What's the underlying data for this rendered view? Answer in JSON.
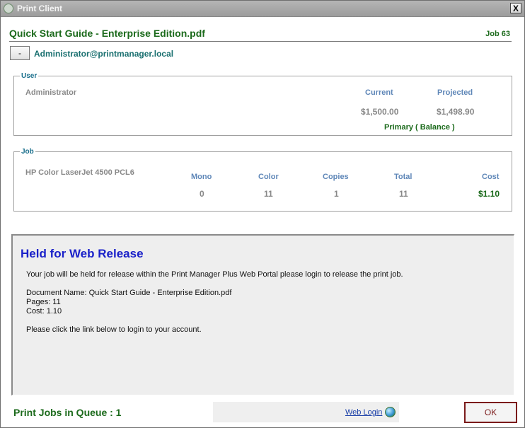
{
  "window": {
    "title": "Print Client",
    "close_glyph": "X"
  },
  "header": {
    "document_title": "Quick Start Guide - Enterprise Edition.pdf",
    "job_label": "Job 63",
    "collapse_label": "-",
    "account": "Administrator@printmanager.local"
  },
  "user": {
    "legend": "User",
    "name": "Administrator",
    "current_label": "Current",
    "projected_label": "Projected",
    "current_value": "$1,500.00",
    "projected_value": "$1,498.90",
    "account_type": "Primary ( Balance )"
  },
  "job": {
    "legend": "Job",
    "printer": "HP Color LaserJet 4500 PCL6",
    "columns": [
      {
        "label": "Mono",
        "value": "0"
      },
      {
        "label": "Color",
        "value": "11"
      },
      {
        "label": "Copies",
        "value": "1"
      },
      {
        "label": "Total",
        "value": "11"
      },
      {
        "label": "Cost",
        "value": "$1.10"
      }
    ]
  },
  "held": {
    "heading": "Held for Web Release",
    "message": "Your job will be held for release within the Print Manager Plus Web Portal please login to release the print job.",
    "document_line": "Document Name: Quick Start Guide - Enterprise Edition.pdf",
    "pages_line": "Pages: 11",
    "cost_line": "Cost: 1.10",
    "instruction": "Please click the link below to login to your account."
  },
  "footer": {
    "queue": "Print Jobs in Queue : 1",
    "web_login": "Web Login",
    "web_login_icon": "globe-icon",
    "ok_label": "OK"
  },
  "colors": {
    "accent_green": "#1b6a1b",
    "heading_blue": "#1a21c9",
    "column_header_blue": "#5f87b8",
    "ok_border": "#7b1a1a"
  }
}
